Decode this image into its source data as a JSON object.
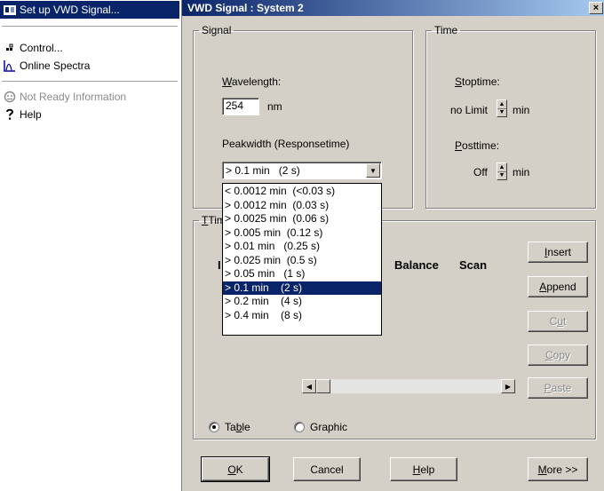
{
  "menu": {
    "items": [
      {
        "label": "Set up VWD Signal...",
        "icon": "signal-setup-icon",
        "state": "selected"
      },
      {
        "label": "Control...",
        "icon": "control-icon",
        "state": "enabled"
      },
      {
        "label": "Online Spectra",
        "icon": "spectra-icon",
        "state": "enabled"
      },
      {
        "label": "Not Ready Information",
        "icon": "not-ready-icon",
        "state": "disabled"
      },
      {
        "label": "Help",
        "icon": "help-icon",
        "state": "enabled"
      }
    ]
  },
  "dialog": {
    "title": "VWD Signal : System 2",
    "close_label": "×",
    "signal": {
      "legend": "Signal",
      "wavelength_label": "Wavelength:",
      "wavelength_value": "254",
      "wavelength_unit": "nm",
      "peakwidth_label": "Peakwidth  (Responsetime)",
      "peakwidth_selected": "> 0.1 min   (2 s)",
      "peakwidth_options": [
        "< 0.0012 min  (<0.03 s)",
        "> 0.0012 min  (0.03 s)",
        "> 0.0025 min  (0.06 s)",
        "> 0.005 min  (0.12 s)",
        "> 0.01 min   (0.25 s)",
        "> 0.025 min  (0.5 s)",
        "> 0.05 min   (1 s)",
        "> 0.1 min    (2 s)",
        "> 0.2 min    (4 s)",
        "> 0.4 min    (8 s)"
      ],
      "peakwidth_selected_index": 7
    },
    "time": {
      "legend": "Time",
      "stoptime_label": "Stoptime:",
      "stoptime_value": "no Limit",
      "stoptime_unit": "min",
      "posttime_label": "Posttime:",
      "posttime_value": "Off",
      "posttime_unit": "min"
    },
    "timetable": {
      "legend_fragment": "Tim",
      "header_fragment": "I",
      "col_balance": "Balance",
      "col_scan": "Scan",
      "buttons": {
        "insert": "Insert",
        "append": "Append",
        "cut": "Cut",
        "copy": "Copy",
        "paste": "Paste"
      }
    },
    "view": {
      "table_label": "Table",
      "graphic_label": "Graphic",
      "selected": "Table"
    },
    "footer": {
      "ok": "OK",
      "cancel": "Cancel",
      "help": "Help",
      "more": "More >>"
    }
  },
  "colors": {
    "selection": "#0a246a",
    "dialog_face": "#d4d0c8",
    "disabled_text": "#8a8a8a"
  }
}
